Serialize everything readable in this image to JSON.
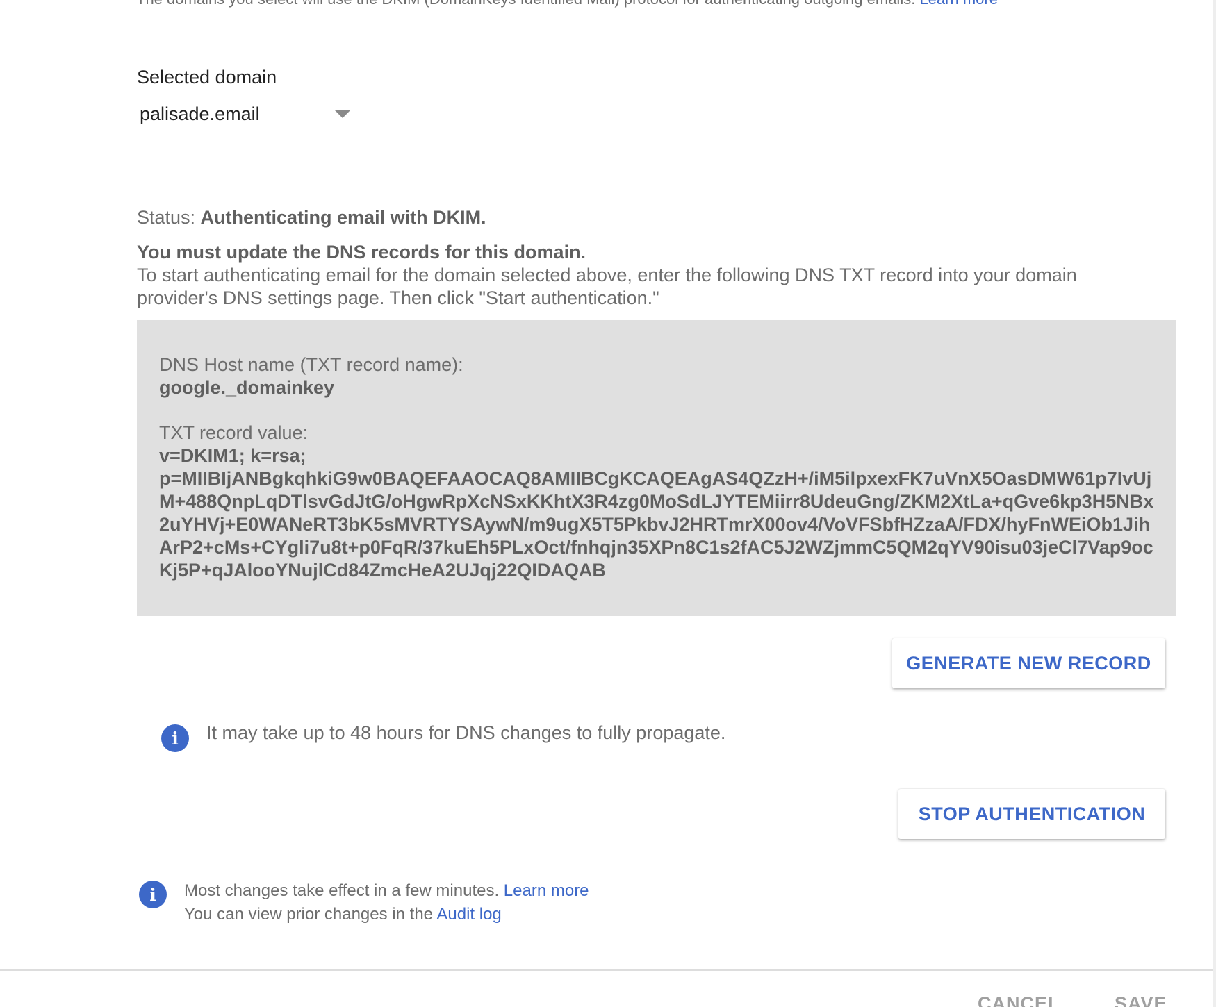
{
  "intro": {
    "text": "The domains you select will use the DKIM (DomainKeys Identified Mail) protocol for authenticating outgoing emails. ",
    "link": "Learn more"
  },
  "domain": {
    "label": "Selected domain",
    "value": "palisade.email"
  },
  "status": {
    "prefix": "Status: ",
    "value": "Authenticating email with DKIM."
  },
  "dns_notice": {
    "heading": "You must update the DNS records for this domain.",
    "body": "To start authenticating email for the domain selected above, enter the following DNS TXT record into your domain provider's DNS settings page. Then click \"Start authentication.\""
  },
  "record": {
    "host_label": "DNS Host name (TXT record name):",
    "host_value": "google._domainkey",
    "txt_label": "TXT record value:",
    "txt_value_line1": "v=DKIM1; k=rsa;",
    "txt_value_key": "p=MIIBIjANBgkqhkiG9w0BAQEFAAOCAQ8AMIIBCgKCAQEAgAS4QZzH+/iM5ilpxexFK7uVnX5OasDMW61p7IvUjM+488QnpLqDTlsvGdJtG/oHgwRpXcNSxKKhtX3R4zg0MoSdLJYTEMiirr8UdeuGng/ZKM2XtLa+qGve6kp3H5NBx2uYHVj+E0WANeRT3bK5sMVRTYSAywN/m9ugX5T5PkbvJ2HRTmrX00ov4/VoVFSbfHZzaA/FDX/hyFnWEiOb1JihArP2+cMs+CYgli7u8t+p0FqR/37kuEh5PLxOct/fnhqjn35XPn8C1s2fAC5J2WZjmmC5QM2qYV90isu03jeCl7Vap9ocKj5P+qJAlooYNujlCd84ZmcHeA2UJqj22QIDAQAB"
  },
  "buttons": {
    "generate": "GENERATE NEW RECORD",
    "stop": "STOP AUTHENTICATION"
  },
  "propagation_note": "It may take up to 48 hours for DNS changes to fully propagate.",
  "changes_note": {
    "line1": "Most changes take effect in a few minutes. ",
    "line1_link": "Learn more",
    "line2": "You can view prior changes in the ",
    "line2_link": "Audit log"
  },
  "footer": {
    "cancel": "CANCEL",
    "save": "SAVE"
  },
  "colors": {
    "accent": "#3d68c8",
    "record_background": "#e0e0e0",
    "body_text": "#6d6d6d"
  },
  "icons": {
    "info": "info-icon",
    "dropdown": "triangle-down-icon"
  }
}
